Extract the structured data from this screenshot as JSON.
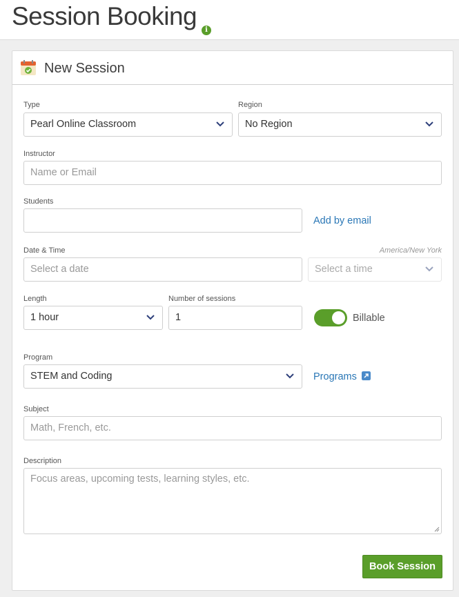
{
  "page": {
    "title": "Session Booking",
    "info_icon": "info-icon",
    "info_glyph": "i"
  },
  "card": {
    "title": "New Session",
    "icon": "calendar-check-icon"
  },
  "form": {
    "type": {
      "label": "Type",
      "value": "Pearl Online Classroom"
    },
    "region": {
      "label": "Region",
      "value": "No Region"
    },
    "instructor": {
      "label": "Instructor",
      "placeholder": "Name or Email",
      "value": ""
    },
    "students": {
      "label": "Students",
      "value": "",
      "add_link": "Add by email"
    },
    "datetime": {
      "label": "Date & Time",
      "timezone": "America/New York",
      "date_placeholder": "Select a date",
      "time_placeholder": "Select a time"
    },
    "length": {
      "label": "Length",
      "value": "1 hour"
    },
    "num_sessions": {
      "label": "Number of sessions",
      "value": "1"
    },
    "billable": {
      "label": "Billable",
      "enabled": true
    },
    "program": {
      "label": "Program",
      "value": "STEM and Coding",
      "link": "Programs"
    },
    "subject": {
      "label": "Subject",
      "placeholder": "Math, French, etc."
    },
    "description": {
      "label": "Description",
      "placeholder": "Focus areas, upcoming tests, learning styles, etc."
    },
    "submit_label": "Book Session"
  },
  "colors": {
    "accent_green": "#5a9e2a",
    "link_blue": "#2a77b6",
    "chevron_navy": "#2d3f7a"
  }
}
